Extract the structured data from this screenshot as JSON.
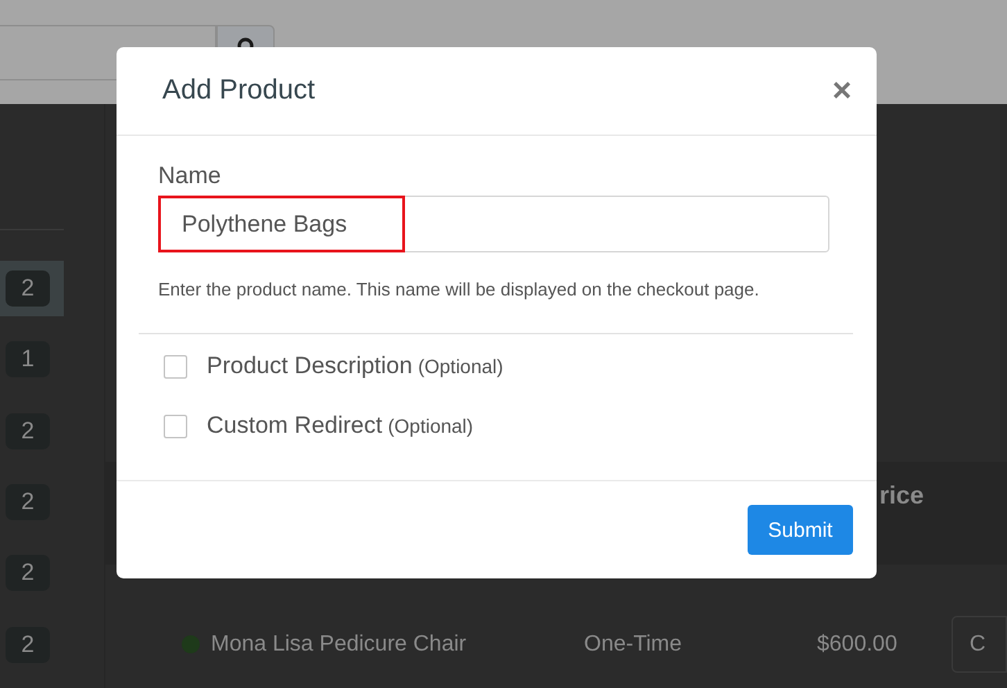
{
  "background": {
    "search_button": {
      "kind": "search"
    },
    "sidebar": {
      "badges": [
        {
          "count": "2",
          "selected": true
        },
        {
          "count": "1",
          "selected": false
        },
        {
          "count": "2",
          "selected": false
        },
        {
          "count": "2",
          "selected": false
        },
        {
          "count": "2",
          "selected": false
        },
        {
          "count": "2",
          "selected": false
        }
      ]
    },
    "table": {
      "columns": [
        "rice"
      ],
      "rows": [
        {
          "color": "#1e3a1a",
          "name": "Mona Lisa Pedicure Chair",
          "type": "One-Time",
          "price": "$600.00",
          "action": "C"
        }
      ]
    }
  },
  "modal": {
    "title": "Add Product",
    "close": "×",
    "name_field": {
      "label": "Name",
      "value": "Polythene Bags",
      "highlighted": true,
      "help": "Enter the product name. This name will be displayed on the checkout page."
    },
    "options": [
      {
        "label": "Product Description",
        "note": "(Optional)",
        "checked": false
      },
      {
        "label": "Custom Redirect",
        "note": "(Optional)",
        "checked": false
      }
    ],
    "submit": "Submit"
  }
}
